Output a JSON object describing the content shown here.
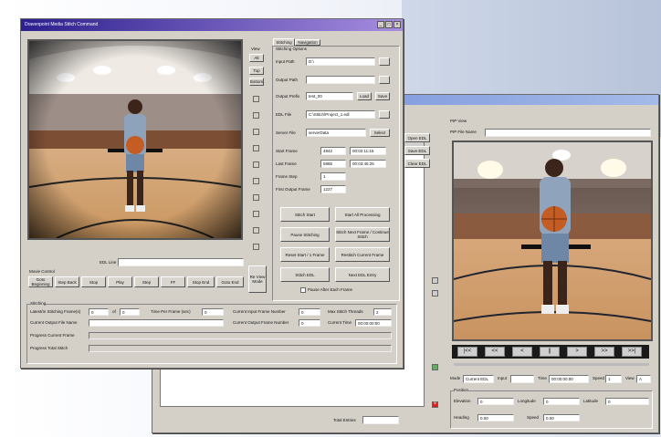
{
  "main_window": {
    "title": "Dravenpoint Media Stitch Command",
    "view_label": "View",
    "view_buttons": [
      "Alt",
      "Top",
      "Bottom"
    ],
    "tabs": [
      "Stitching",
      "Navigation"
    ],
    "section_stitching_options": "Stitching Options",
    "fields": [
      {
        "label": "Input Path",
        "value": "D:\\"
      },
      {
        "label": "Output Path",
        "value": ""
      },
      {
        "label": "Output Prefix",
        "value": "test_00"
      },
      {
        "label": "EDL File",
        "value": "C:\\Stitch\\Project_1.edl"
      },
      {
        "label": "Server File",
        "value": "serverData"
      }
    ],
    "btn_load": "Load",
    "btn_save": "Save",
    "btn_select": "Select",
    "frames": [
      {
        "label": "Start Frame",
        "a": "4842",
        "b": "00:02:11:15"
      },
      {
        "label": "Last Frame",
        "a": "5885",
        "b": "00:03:45:25"
      },
      {
        "label": "Frame Step",
        "a": "1",
        "b": ""
      },
      {
        "label": "First Output Frame",
        "a": "1227",
        "b": ""
      }
    ],
    "action_buttons": [
      "Stitch Start",
      "Start All Processing",
      "Pause Stitching",
      "Stitch Next Frame / Continue Stitch",
      "Reset Start / 1 Frame",
      "Restitch Current Frame",
      "Stitch EDL",
      "Next EDL Entry"
    ],
    "pause_checkbox": "Pause After Each Frame",
    "edl_line_label": "EDL Line",
    "movie_control_label": "Movie Control",
    "movie_buttons": [
      "Goto Beginning",
      "Step Back",
      "Stop",
      "Play",
      "Step",
      "FF",
      "Stop End",
      "Goto End"
    ],
    "re_view_label": "Re View Mode",
    "status_group": "Stitching",
    "status_rows": [
      {
        "label": "Latest/In Stitching Frame(s)",
        "value": "0",
        "of_label": "of",
        "of_value": "0"
      },
      {
        "label": "Current Output File Name",
        "value": ""
      },
      {
        "label": "Progress Current Frame",
        "value": ""
      },
      {
        "label": "Progress Total Stitch",
        "value": ""
      }
    ],
    "time_per_frame_label": "Time Per Frame (sec)",
    "time_per_frame_value": "0",
    "current_input_label": "Current Input Frame Number",
    "current_output_label": "Current Output Frame Number",
    "current_input_value": "0",
    "current_output_value": "0",
    "max_stitch_label": "Max Stitch Threads",
    "max_stitch_value": "2",
    "current_time_label": "Current Time",
    "current_time_value": "00:00:00:00"
  },
  "back_window": {
    "pip_view_label": "PIP View",
    "pip_file_label": "PIP File Name",
    "pip_file_value": "",
    "side_buttons": [
      "Open EDL",
      "Save EDL",
      "Clear EDL"
    ],
    "controls": [
      "|<<",
      "<<",
      "<",
      "||",
      ">",
      ">>",
      ">>|"
    ],
    "mode_label": "Mode",
    "mode_value": "Current EDL",
    "input_label": "Input",
    "input_value": "",
    "time_label": "Time",
    "time_value": "00:00:00:00",
    "speed_label": "Speed",
    "speed_value": "1",
    "view_label": "View",
    "view_value": "A",
    "position_label": "Position",
    "elevation_label": "Elevation",
    "elevation_value": "0",
    "longitude_label": "Longitude",
    "longitude_value": "0",
    "latitude_label": "Latitude",
    "latitude_value": "0",
    "heading_label": "Heading",
    "heading_value": "0.00",
    "speed2_label": "Speed",
    "speed2_value": "0.00",
    "total_label": "Total Entries",
    "total_value": ""
  },
  "colors": {
    "title_active": "#2c1f8e",
    "title_inactive": "#6a86d8",
    "chrome": "#d4d0c8",
    "delete_red": "#d02020"
  }
}
